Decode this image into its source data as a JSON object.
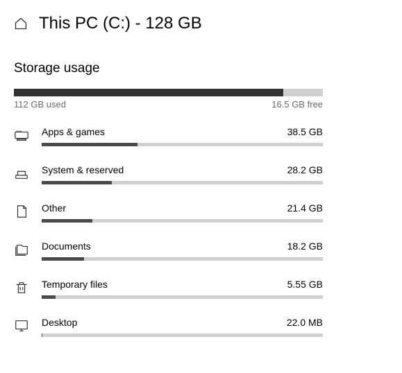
{
  "header": {
    "title": "This PC (C:) - 128 GB"
  },
  "section": {
    "title": "Storage usage"
  },
  "main_bar": {
    "used_label": "112 GB used",
    "free_label": "16.5 GB free",
    "used_percent": 87.1
  },
  "categories": [
    {
      "icon": "apps",
      "name": "Apps & games",
      "size": "38.5 GB",
      "percent": 34
    },
    {
      "icon": "system",
      "name": "System & reserved",
      "size": "28.2 GB",
      "percent": 25
    },
    {
      "icon": "other",
      "name": "Other",
      "size": "21.4 GB",
      "percent": 18
    },
    {
      "icon": "documents",
      "name": "Documents",
      "size": "18.2 GB",
      "percent": 15
    },
    {
      "icon": "temp",
      "name": "Temporary files",
      "size": "5.55 GB",
      "percent": 5
    },
    {
      "icon": "desktop",
      "name": "Desktop",
      "size": "22.0 MB",
      "percent": 0.3
    }
  ]
}
